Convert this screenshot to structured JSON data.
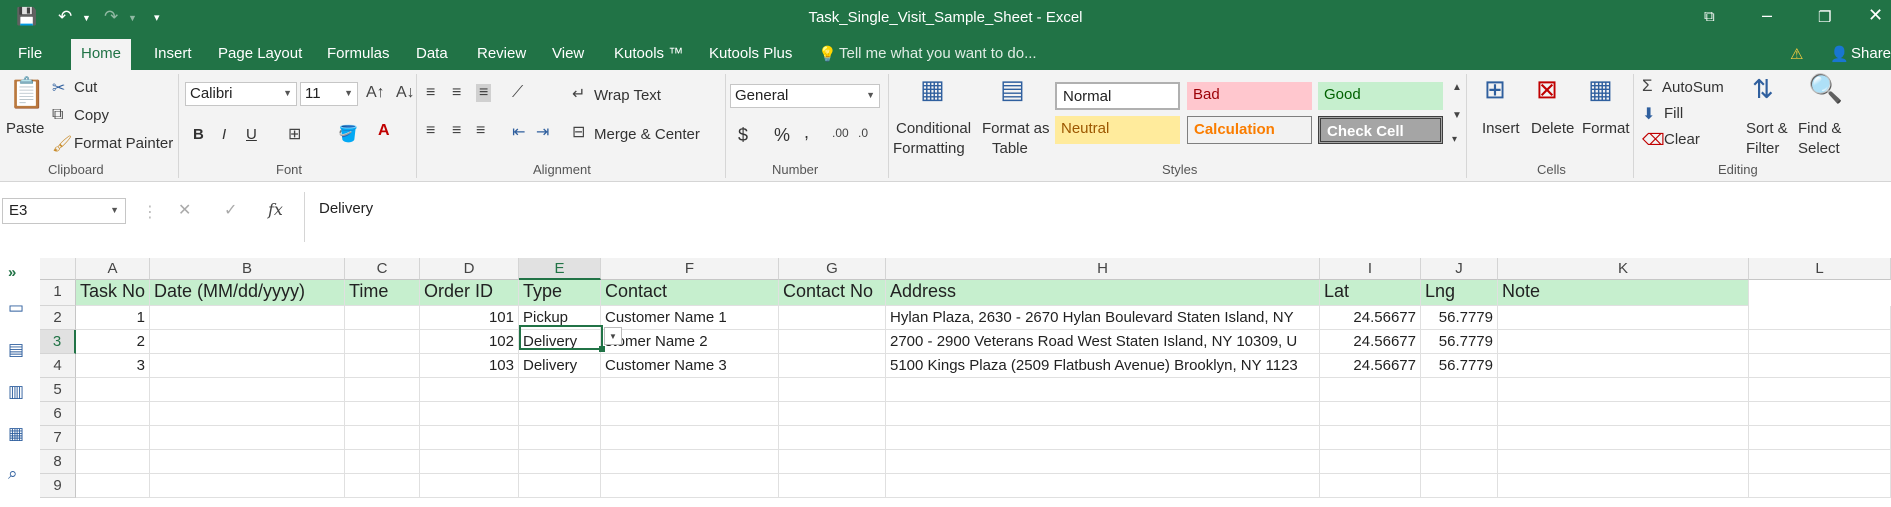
{
  "window": {
    "title": "Task_Single_Visit_Sample_Sheet - Excel"
  },
  "tabs": [
    "File",
    "Home",
    "Insert",
    "Page Layout",
    "Formulas",
    "Data",
    "Review",
    "View",
    "Kutools ™",
    "Kutools Plus"
  ],
  "tell_me": "Tell me what you want to do...",
  "share": "Share",
  "clipboard": {
    "paste": "Paste",
    "cut": "Cut",
    "copy": "Copy",
    "format_painter": "Format Painter",
    "group": "Clipboard"
  },
  "font": {
    "name": "Calibri",
    "size": "11",
    "bold": "B",
    "italic": "I",
    "underline": "U",
    "group": "Font"
  },
  "alignment": {
    "wrap_text": "Wrap Text",
    "merge_center": "Merge & Center",
    "group": "Alignment"
  },
  "number": {
    "format": "General",
    "currency": "$",
    "percent": "%",
    "comma": ",",
    "group": "Number"
  },
  "styles": {
    "conditional": "Conditional",
    "formatting": "Formatting",
    "format_as": "Format as",
    "table": "Table",
    "normal": "Normal",
    "bad": "Bad",
    "good": "Good",
    "neutral": "Neutral",
    "calculation": "Calculation",
    "check_cell": "Check Cell",
    "group": "Styles",
    "colors": {
      "bad_bg": "#ffc7ce",
      "bad_fg": "#9c0006",
      "good_bg": "#c6efce",
      "good_fg": "#006100",
      "neutral_bg": "#ffeb9c",
      "neutral_fg": "#9c5700",
      "calc_fg": "#fa7d00",
      "check_bg": "#a5a5a5"
    }
  },
  "cells_group": {
    "insert": "Insert",
    "delete": "Delete",
    "format": "Format",
    "group": "Cells"
  },
  "editing": {
    "autosum": "AutoSum",
    "fill": "Fill",
    "clear": "Clear",
    "sort": "Sort &",
    "filter": "Filter",
    "find": "Find &",
    "select": "Select",
    "group": "Editing"
  },
  "formula_bar": {
    "name_box": "E3",
    "fx": "fx",
    "content": "Delivery"
  },
  "columns": [
    "A",
    "B",
    "C",
    "D",
    "E",
    "F",
    "G",
    "H",
    "I",
    "J",
    "K",
    "L"
  ],
  "rows": [
    "1",
    "2",
    "3",
    "4",
    "5",
    "6",
    "7",
    "8",
    "9"
  ],
  "headers": [
    "Task No",
    "Date (MM/dd/yyyy)",
    "Time",
    "Order ID",
    "Type",
    "Contact",
    "Contact No",
    "Address",
    "Lat",
    "Lng",
    "Note"
  ],
  "data": [
    [
      "1",
      "",
      "",
      "101",
      "Pickup",
      "Customer Name 1",
      "",
      "Hylan Plaza, 2630 - 2670 Hylan Boulevard Staten Island, NY",
      "24.56677",
      "56.7779",
      ""
    ],
    [
      "2",
      "",
      "",
      "102",
      "Delivery",
      "stomer Name 2",
      "",
      "2700 - 2900 Veterans Road West Staten Island, NY 10309, U",
      "24.56677",
      "56.7779",
      ""
    ],
    [
      "3",
      "",
      "",
      "103",
      "Delivery",
      "Customer Name 3",
      "",
      "5100 Kings Plaza (2509 Flatbush Avenue) Brooklyn, NY 1123",
      "24.56677",
      "56.7779",
      ""
    ]
  ],
  "accent": "#217346",
  "header_fill": "#c6efce"
}
